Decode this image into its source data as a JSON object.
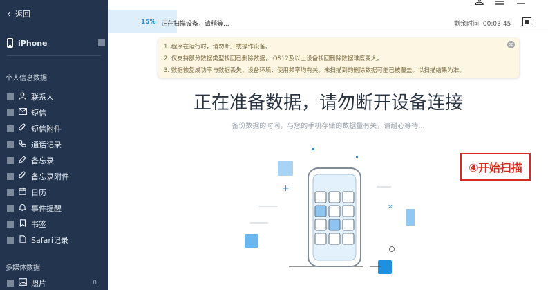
{
  "sidebar": {
    "back_label": "返回",
    "device_name": "iPhone",
    "section_personal": "个人信息数据",
    "items": [
      {
        "label": "联系人",
        "icon": "person-icon"
      },
      {
        "label": "短信",
        "icon": "mail-icon"
      },
      {
        "label": "短信附件",
        "icon": "paperclip-icon"
      },
      {
        "label": "通话记录",
        "icon": "phone-icon"
      },
      {
        "label": "备忘录",
        "icon": "note-icon"
      },
      {
        "label": "备忘录附件",
        "icon": "paperclip-icon"
      },
      {
        "label": "日历",
        "icon": "calendar-icon"
      },
      {
        "label": "事件提醒",
        "icon": "bell-icon"
      },
      {
        "label": "书签",
        "icon": "bookmark-icon"
      },
      {
        "label": "Safari记录",
        "icon": "document-icon"
      }
    ],
    "section_media": "多媒体数据",
    "media_item": {
      "label": "照片",
      "count": "0",
      "icon": "photo-icon"
    }
  },
  "progress": {
    "percent_label": "15%",
    "percent": 15,
    "status": "正在扫描设备，请稍等...",
    "remaining": "剩余时间: 00:03:45"
  },
  "notice": {
    "lines": [
      "1. 程序在运行时，请勿断开或操作设备。",
      "2. 仅支持部分数据类型找回已删除数据，IOS12及以上设备找回删除数据难度变大。",
      "3. 数据恢复成功率与数据丢失、设备环境、使用频率均有关。未扫描到的删除数据可能已被覆盖。以扫描结果为准。"
    ]
  },
  "main": {
    "title": "正在准备数据，请勿断开设备连接",
    "subtitle": "备份数据的时间，与您的手机存储的数据量有关，请耐心等待..."
  },
  "annotation": "④开始扫描",
  "colors": {
    "sidebar_bg": "#22344e",
    "accent": "#1f8fe0",
    "annotation": "#d8291e",
    "notice_bg": "#fdf6e3"
  }
}
